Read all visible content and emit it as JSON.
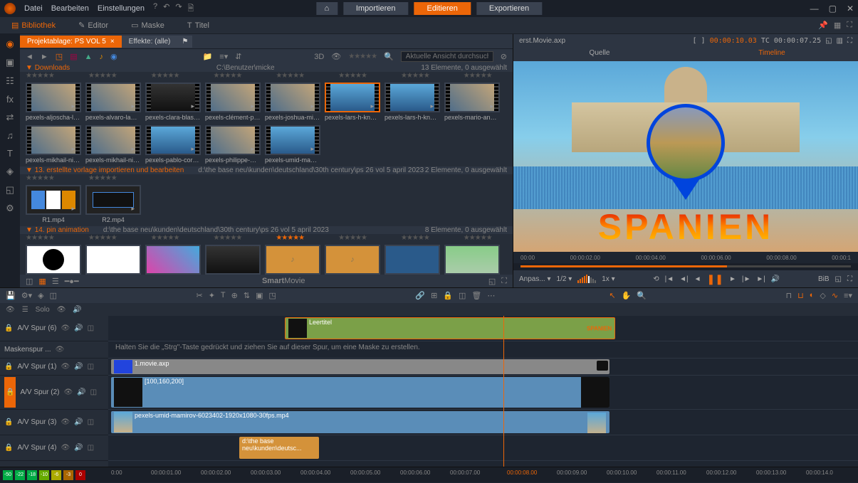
{
  "menubar": {
    "items": [
      "Datei",
      "Bearbeiten",
      "Einstellungen"
    ],
    "center": {
      "import": "Importieren",
      "edit": "Editieren",
      "export": "Exportieren"
    }
  },
  "modes": {
    "library": "Bibliothek",
    "editor": "Editor",
    "mask": "Maske",
    "title": "Titel"
  },
  "library": {
    "tab1": "Projektablage: PS VOL 5",
    "tab2": "Effekte: (alle)",
    "search_placeholder": "Aktuelle Ansicht durchsuchen",
    "threeD": "3D",
    "section1": {
      "title": "Downloads",
      "path": "C:\\Benutzer\\micke",
      "count": "13 Elemente, 0 ausgewählt"
    },
    "thumbs1": [
      {
        "label": "pexels-aljoscha-lasc..."
      },
      {
        "label": "pexels-alvaro-lama-..."
      },
      {
        "label": "pexels-clara-blasco-..."
      },
      {
        "label": "pexels-clément-prou..."
      },
      {
        "label": "pexels-joshua-mirins..."
      },
      {
        "label": "pexels-lars-h-knuds..."
      },
      {
        "label": "pexels-lars-h-knuds..."
      },
      {
        "label": "pexels-mario-angel-..."
      },
      {
        "label": "pexels-mikhail-nilov..."
      },
      {
        "label": "pexels-mikhail-nilov..."
      },
      {
        "label": "pexels-pablo-corder..."
      },
      {
        "label": "pexels-philippe-weic..."
      },
      {
        "label": "pexels-umid-mamir..."
      }
    ],
    "section2": {
      "title": "13. erstellte vorlage importieren und bearbeiten",
      "path": "d:\\the base neu\\kunden\\deutschland\\30th century\\ps 26 vol 5 april 2023",
      "count": "2 Elemente, 0 ausgewählt"
    },
    "thumbs2": [
      {
        "label": "R1.mp4"
      },
      {
        "label": "R2.mp4"
      }
    ],
    "section3": {
      "title": "14. pin animation",
      "path": "d:\\the base neu\\kunden\\deutschland\\30th century\\ps 26 vol 5 april 2023",
      "count": "8 Elemente, 0 ausgewählt"
    },
    "smartmovie": "SmartMovie"
  },
  "preview": {
    "filename": "erst.Movie.axp",
    "tc1": "00:00:10.03",
    "tc2": "00:00:07.25",
    "tab_source": "Quelle",
    "tab_timeline": "Timeline",
    "text": "SPANIEN",
    "ruler": [
      "00:00",
      "00:00:02.00",
      "00:00:04.00",
      "00:00:06.00",
      "00:00:08.00",
      "00:00:1"
    ],
    "fit": "Anpas...",
    "zoom": "1/2",
    "speed": "1x",
    "bib": "BiB"
  },
  "timeline": {
    "solo": "Solo",
    "tracks": [
      {
        "name": "A/V Spur (6)"
      },
      {
        "name": "Maskenspur ..."
      },
      {
        "name": "A/V Spur (1)"
      },
      {
        "name": "A/V Spur (2)"
      },
      {
        "name": "A/V Spur (3)"
      },
      {
        "name": "A/V Spur (4)"
      }
    ],
    "mask_hint": "Halten Sie die „Strg\"-Taste gedrückt und ziehen Sie auf dieser Spur, um eine Maske zu erstellen.",
    "clip_leertitel": "Leertitel",
    "clip_spanien": "SPANIEN",
    "clip_movie": "1.movie.axp",
    "clip_100": "[100,160,200]",
    "clip_pexels": "pexels-umid-mamirov-6023402-1920x1080-30fps.mp4",
    "clip_audio": "d:\\the base neu\\kunden\\deutsc...",
    "ruler": [
      "0:00",
      "00:00:01.00",
      "00:00:02.00",
      "00:00:03.00",
      "00:00:04.00",
      "00:00:05.00",
      "00:00:06.00",
      "00:00:07.00",
      "00:00:08.00",
      "00:00:09.00",
      "00:00:10.00",
      "00:00:11.00",
      "00:00:12.00",
      "00:00:13.00",
      "00:00:14.0"
    ],
    "db": [
      "-50",
      "-22",
      "-18",
      "-10",
      "-6",
      "-3",
      "0"
    ]
  }
}
